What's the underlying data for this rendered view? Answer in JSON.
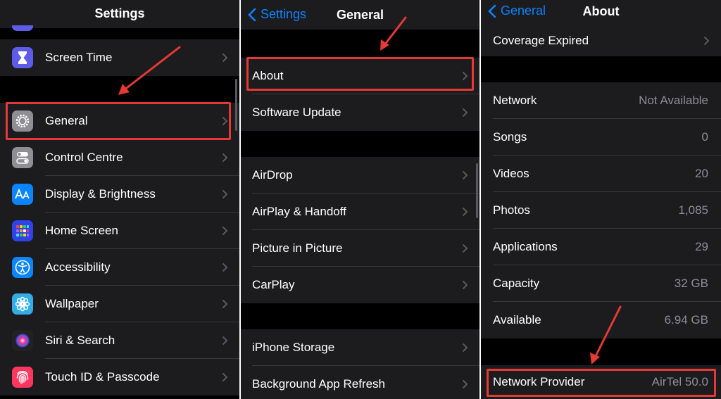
{
  "panel1": {
    "title": "Settings",
    "items": [
      {
        "label": "Screen Time",
        "icon": "hourglass-icon",
        "color": "#5e5ce6"
      },
      {
        "label": "General",
        "icon": "gear-icon",
        "color": "#8e8e93"
      },
      {
        "label": "Control Centre",
        "icon": "toggles-icon",
        "color": "#8e8e93"
      },
      {
        "label": "Display & Brightness",
        "icon": "text-size-icon",
        "color": "#0a84ff"
      },
      {
        "label": "Home Screen",
        "icon": "app-grid-icon",
        "color": "#2c44e8"
      },
      {
        "label": "Accessibility",
        "icon": "accessibility-icon",
        "color": "#0a84ff"
      },
      {
        "label": "Wallpaper",
        "icon": "flower-icon",
        "color": "#32ade6"
      },
      {
        "label": "Siri & Search",
        "icon": "siri-icon",
        "color": "#222222"
      },
      {
        "label": "Touch ID & Passcode",
        "icon": "fingerprint-icon",
        "color": "#ff375f"
      }
    ]
  },
  "panel2": {
    "back_label": "Settings",
    "title": "General",
    "items": [
      {
        "label": "About"
      },
      {
        "label": "Software Update"
      },
      {
        "label": "AirDrop"
      },
      {
        "label": "AirPlay & Handoff"
      },
      {
        "label": "Picture in Picture"
      },
      {
        "label": "CarPlay"
      },
      {
        "label": "iPhone Storage"
      },
      {
        "label": "Background App Refresh"
      }
    ]
  },
  "panel3": {
    "back_label": "General",
    "title": "About",
    "coverage": {
      "label": "Coverage Expired"
    },
    "rows": [
      {
        "label": "Network",
        "value": "Not Available"
      },
      {
        "label": "Songs",
        "value": "0"
      },
      {
        "label": "Videos",
        "value": "20"
      },
      {
        "label": "Photos",
        "value": "1,085"
      },
      {
        "label": "Applications",
        "value": "29"
      },
      {
        "label": "Capacity",
        "value": "32 GB"
      },
      {
        "label": "Available",
        "value": "6.94 GB"
      }
    ],
    "provider": {
      "label": "Network Provider",
      "value": "AirTel 50.0"
    }
  },
  "colors": {
    "accent": "#0a84ff",
    "highlight": "#e53935",
    "row_bg": "#1c1c1e",
    "bg": "#000000"
  }
}
